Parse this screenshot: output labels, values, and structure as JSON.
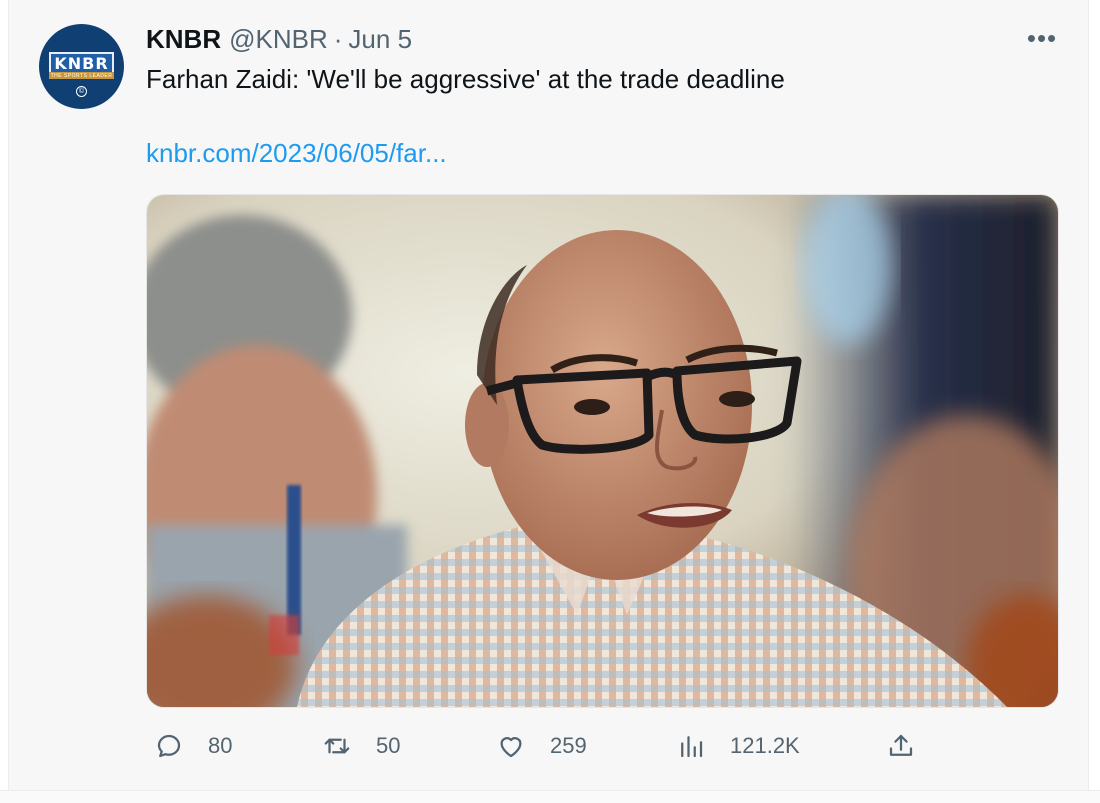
{
  "author": {
    "name": "KNBR",
    "handle": "@KNBR",
    "separator": "·",
    "date": "Jun 5",
    "avatar_logo": "KNBR",
    "avatar_tagline": "THE SPORTS LEADER",
    "avatar_mark": "©"
  },
  "menu": {
    "icon": "more-horizontal-icon",
    "label": "•••"
  },
  "tweet": {
    "text": "Farhan Zaidi: 'We'll be aggressive' at the trade deadline",
    "link": "knbr.com/2023/06/05/far..."
  },
  "actions": {
    "reply": {
      "icon": "reply-icon",
      "count": "80"
    },
    "retweet": {
      "icon": "retweet-icon",
      "count": "50"
    },
    "like": {
      "icon": "heart-icon",
      "count": "259"
    },
    "views": {
      "icon": "views-chart-icon",
      "count": "121.2K"
    },
    "share": {
      "icon": "share-icon"
    }
  },
  "colors": {
    "text": "#0f1419",
    "muted": "#536471",
    "link": "#1d9bf0",
    "background": "#f7f7f7",
    "avatar": "#0f3f73"
  }
}
